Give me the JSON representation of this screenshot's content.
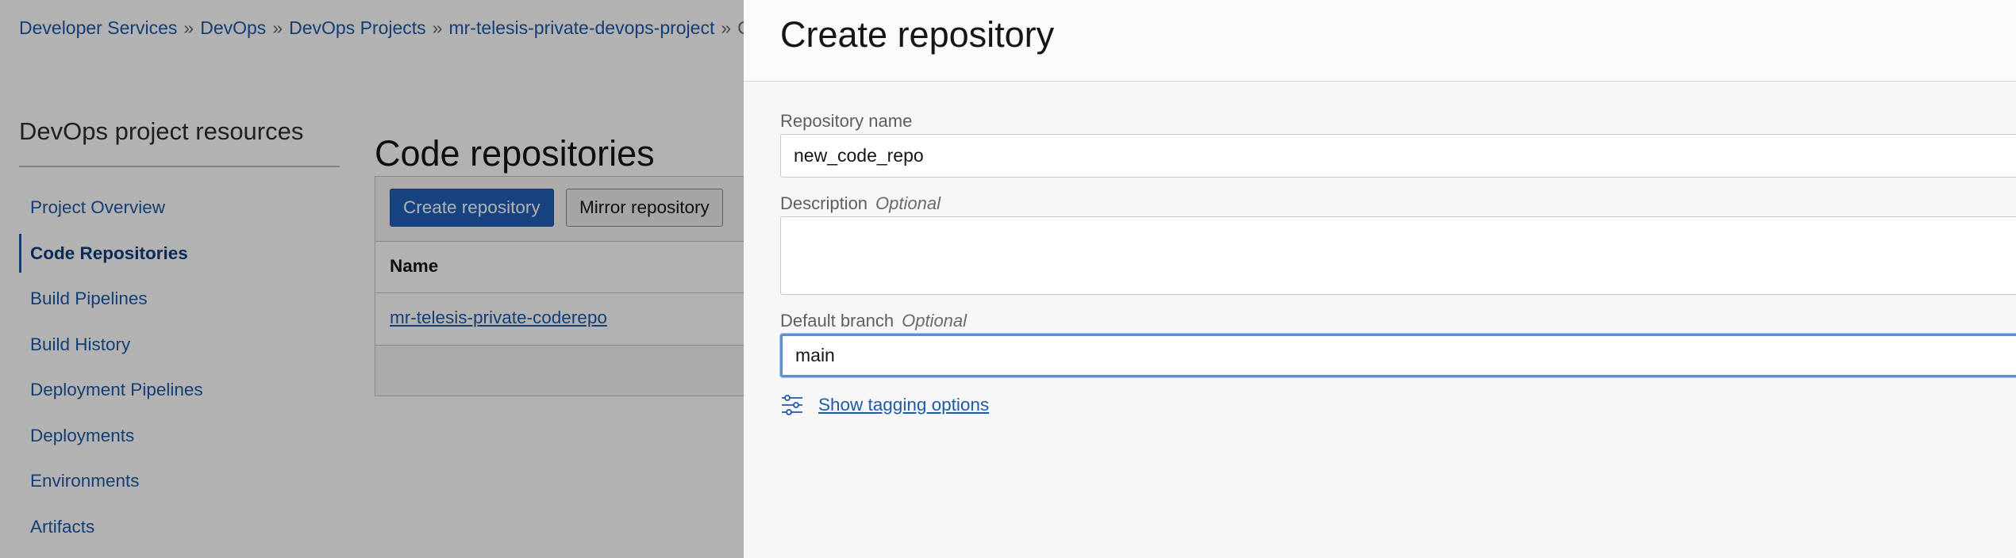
{
  "breadcrumb": {
    "items": [
      "Developer Services",
      "DevOps",
      "DevOps Projects",
      "mr-telesis-private-devops-project"
    ],
    "current": "Cod",
    "separator": "»"
  },
  "sidebar": {
    "title": "DevOps project resources",
    "items": [
      {
        "label": "Project Overview",
        "active": false
      },
      {
        "label": "Code Repositories",
        "active": true
      },
      {
        "label": "Build Pipelines",
        "active": false
      },
      {
        "label": "Build History",
        "active": false
      },
      {
        "label": "Deployment Pipelines",
        "active": false
      },
      {
        "label": "Deployments",
        "active": false
      },
      {
        "label": "Environments",
        "active": false
      },
      {
        "label": "Artifacts",
        "active": false
      }
    ]
  },
  "main": {
    "title": "Code repositories",
    "create_button": "Create repository",
    "mirror_button": "Mirror repository",
    "table": {
      "columns": [
        "Name"
      ],
      "rows": [
        [
          "mr-telesis-private-coderepo"
        ]
      ]
    }
  },
  "drawer": {
    "title": "Create repository",
    "repo_name": {
      "label": "Repository name",
      "value": "new_code_repo"
    },
    "description": {
      "label": "Description",
      "optional": "Optional",
      "value": ""
    },
    "default_branch": {
      "label": "Default branch",
      "optional": "Optional",
      "value": "main"
    },
    "tagging_link": "Show tagging options",
    "tagging_icon": "sliders-icon"
  },
  "colors": {
    "link": "#1e5aa6",
    "primary_button": "#2262b8",
    "focus_ring": "#5b8fd6",
    "drawer_background": "#f7f7f7"
  }
}
